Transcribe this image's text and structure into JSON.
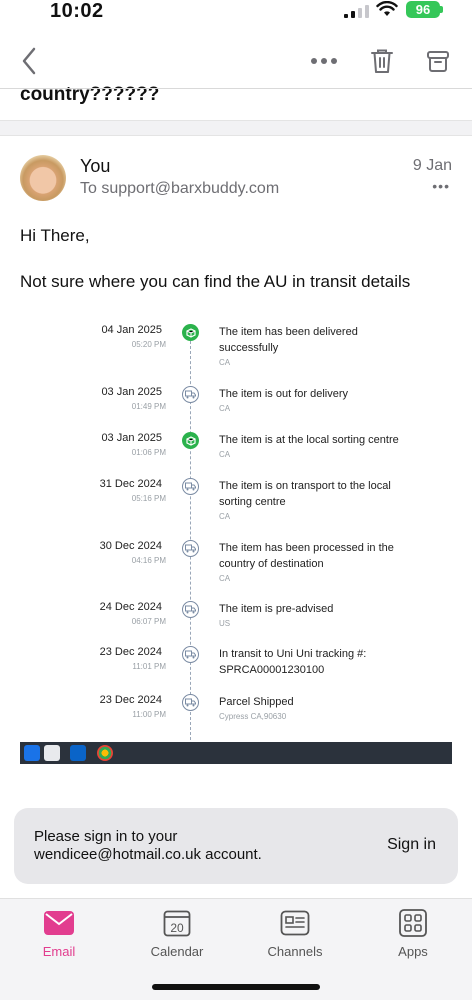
{
  "status_bar": {
    "time": "10:02",
    "battery": "96"
  },
  "header": {
    "subject_partial": "country??????"
  },
  "message": {
    "sender": "You",
    "to": "To support@barxbuddy.com",
    "date": "9 Jan",
    "greeting": "Hi There,",
    "body": "Not sure where you can find the AU in transit details"
  },
  "tracking": [
    {
      "date": "04 Jan 2025",
      "time": "05:20 PM",
      "desc": "The item has been delivered successfully",
      "loc": "CA",
      "icon": "package-green"
    },
    {
      "date": "03 Jan 2025",
      "time": "01:49 PM",
      "desc": "The item is out for delivery",
      "loc": "CA",
      "icon": "truck"
    },
    {
      "date": "03 Jan 2025",
      "time": "01:06 PM",
      "desc": "The item is at the local sorting centre",
      "loc": "CA",
      "icon": "package-green"
    },
    {
      "date": "31 Dec 2024",
      "time": "05:16 PM",
      "desc": "The item is on transport to the local sorting centre",
      "loc": "CA",
      "icon": "truck"
    },
    {
      "date": "30 Dec 2024",
      "time": "04:16 PM",
      "desc": "The item has been processed in the country of destination",
      "loc": "CA",
      "icon": "truck"
    },
    {
      "date": "24 Dec 2024",
      "time": "06:07 PM",
      "desc": "The item is pre-advised",
      "loc": "US",
      "icon": "truck"
    },
    {
      "date": "23 Dec 2024",
      "time": "11:01 PM",
      "desc": "In transit to Uni Uni tracking #: SPRCA00001230100",
      "loc": "",
      "icon": "truck"
    },
    {
      "date": "23 Dec 2024",
      "time": "11:00 PM",
      "desc": "Parcel Shipped",
      "loc": "Cypress CA,90630",
      "icon": "truck"
    }
  ],
  "signin": {
    "text": "Please sign in to your wendicee@hotmail.co.uk account.",
    "button": "Sign in"
  },
  "tabs": [
    {
      "label": "Email",
      "icon": "mail-icon",
      "active": true
    },
    {
      "label": "Calendar",
      "icon": "calendar-icon",
      "day": "20"
    },
    {
      "label": "Channels",
      "icon": "channels-icon"
    },
    {
      "label": "Apps",
      "icon": "apps-icon"
    }
  ],
  "colors": {
    "accent": "#e23d8f",
    "green": "#2bb24c",
    "battery": "#35c759"
  }
}
